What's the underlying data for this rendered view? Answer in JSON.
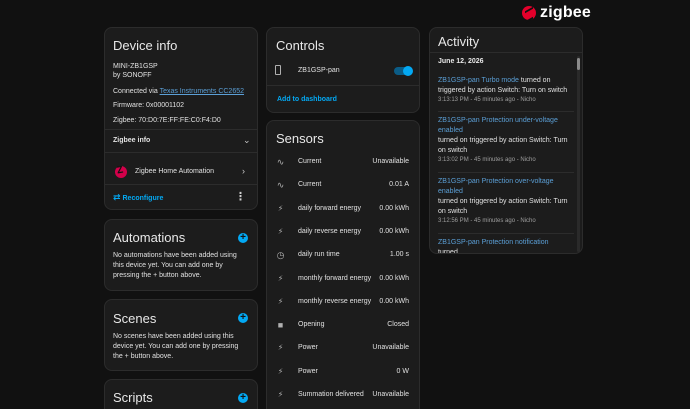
{
  "brand": {
    "name": "zigbee",
    "color": "#e4002b"
  },
  "device_info": {
    "title": "Device info",
    "model": "MINI-ZB1GSP",
    "manufacturer": "by SONOFF",
    "connected_prefix": "Connected via ",
    "connected_link": "Texas Instruments CC2652",
    "firmware": "Firmware: 0x00001102",
    "zigbee_id": "Zigbee: 70:D0:7E:FF:FE:C0:F4:D0",
    "zigbee_info_label": "Zigbee info",
    "integration_label": "Zigbee Home Automation",
    "reconfigure_label": "Reconfigure"
  },
  "automations": {
    "title": "Automations",
    "desc": "No automations have been added using this device yet. You can add one by pressing the + button above."
  },
  "scenes": {
    "title": "Scenes",
    "desc": "No scenes have been added using this device yet. You can add one by pressing the + button above."
  },
  "scripts": {
    "title": "Scripts"
  },
  "controls": {
    "title": "Controls",
    "entity": "ZB1GSP-pan",
    "toggle_on": true,
    "add_to_dashboard": "Add to dashboard"
  },
  "sensors": {
    "title": "Sensors",
    "rows": [
      {
        "icon": "current-icon",
        "name": "Current",
        "value": "Unavailable"
      },
      {
        "icon": "current-icon",
        "name": "Current",
        "value": "0.01 A"
      },
      {
        "icon": "flash-icon",
        "name": "daily forward energy",
        "value": "0.00 kWh"
      },
      {
        "icon": "flash-icon",
        "name": "daily reverse energy",
        "value": "0.00 kWh"
      },
      {
        "icon": "timer-icon",
        "name": "daily run time",
        "value": "1.00 s"
      },
      {
        "icon": "flash-icon",
        "name": "monthly forward energy",
        "value": "0.00 kWh"
      },
      {
        "icon": "flash-icon",
        "name": "monthly reverse energy",
        "value": "0.00 kWh"
      },
      {
        "icon": "square-icon",
        "name": "Opening",
        "value": "Closed"
      },
      {
        "icon": "flash-icon",
        "name": "Power",
        "value": "Unavailable"
      },
      {
        "icon": "flash-icon",
        "name": "Power",
        "value": "0 W"
      },
      {
        "icon": "flash-icon",
        "name": "Summation delivered",
        "value": "Unavailable"
      }
    ]
  },
  "activity": {
    "title": "Activity",
    "date": "June 12, 2026",
    "entries": [
      {
        "name": "ZB1GSP-pan Turbo mode",
        "text_after": " turned on",
        "line2": "triggered by action Switch: Turn on switch",
        "time": "3:13:13 PM - 45 minutes ago - Nicho"
      },
      {
        "name": "ZB1GSP-pan Protection under-voltage enabled",
        "text_after": "",
        "line2": "turned on triggered by action Switch: Turn on switch",
        "time": "3:13:02 PM - 45 minutes ago - Nicho"
      },
      {
        "name": "ZB1GSP-pan Protection over-voltage enabled",
        "text_after": "",
        "line2": "turned on triggered by action Switch: Turn on switch",
        "time": "3:12:56 PM - 45 minutes ago - Nicho"
      },
      {
        "name": "ZB1GSP-pan Protection notification",
        "text_after": " turned",
        "line2": "",
        "time": ""
      }
    ]
  }
}
